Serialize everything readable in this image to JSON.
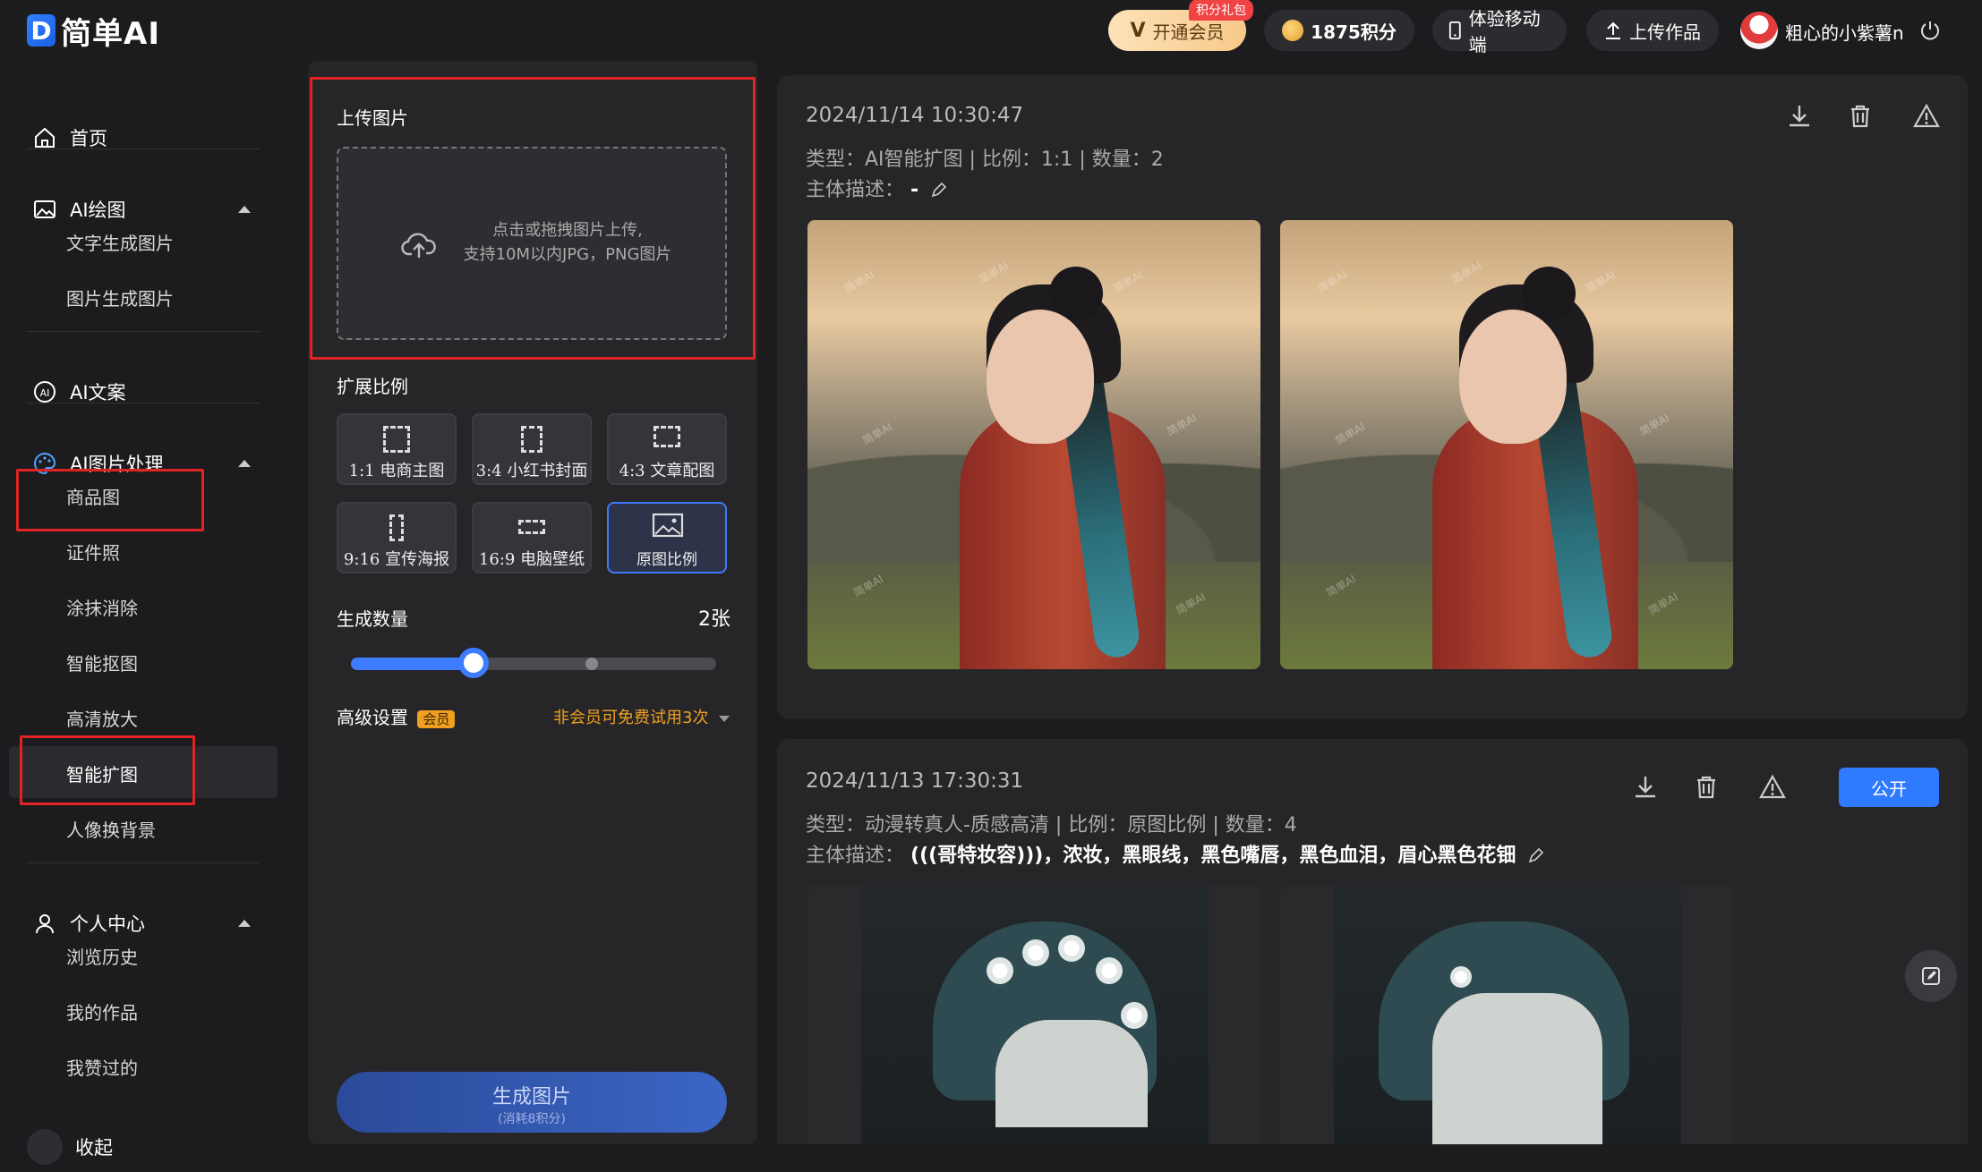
{
  "brand": {
    "logo_letter": "D",
    "name": "简单AI"
  },
  "topbar": {
    "vip": {
      "label": "开通会员",
      "badge": "积分礼包"
    },
    "points": {
      "label": "1875积分"
    },
    "mobile": {
      "label": "体验移动端"
    },
    "upload": {
      "label": "上传作品"
    },
    "user": {
      "name": "粗心的小紫薯n"
    }
  },
  "sidebar": {
    "home": "首页",
    "ai_draw": {
      "label": "AI绘图",
      "items": [
        "文字生成图片",
        "图片生成图片"
      ]
    },
    "ai_copy": "AI文案",
    "ai_image": {
      "label": "AI图片处理",
      "items": [
        "商品图",
        "证件照",
        "涂抹消除",
        "智能抠图",
        "高清放大",
        "智能扩图",
        "人像换背景"
      ]
    },
    "personal": {
      "label": "个人中心",
      "items": [
        "浏览历史",
        "我的作品",
        "我赞过的"
      ]
    },
    "collapse": "收起"
  },
  "panel": {
    "upload_title": "上传图片",
    "upload_hint_1": "点击或拖拽图片上传,",
    "upload_hint_2": "支持10M以内JPG，PNG图片",
    "ratio_title": "扩展比例",
    "ratios": [
      "1:1 电商主图",
      "3:4 小红书封面",
      "4:3 文章配图",
      "9:16 宣传海报",
      "16:9 电脑壁纸",
      "原图比例"
    ],
    "count_title": "生成数量",
    "count_value": "2张",
    "slider_value": 2,
    "advanced_label": "高级设置",
    "advanced_badge": "会员",
    "advanced_note": "非会员可免费试用3次",
    "generate_label": "生成图片",
    "generate_sub": "(消耗8积分)"
  },
  "results": [
    {
      "timestamp": "2024/11/14 10:30:47",
      "meta": "类型：AI智能扩图 | 比例：1:1 | 数量：2",
      "desc_label": "主体描述：",
      "desc_value": "-"
    },
    {
      "timestamp": "2024/11/13 17:30:31",
      "meta": "类型：动漫转真人-质感高清 | 比例：原图比例 | 数量：4",
      "desc_label": "主体描述：",
      "desc_value": "(((哥特妆容)))，浓妆，黑眼线，黑色嘴唇，黑色血泪，眉心黑色花钿",
      "public_label": "公开"
    }
  ],
  "watermark": "简单AI",
  "colors": {
    "accent": "#3d7cff",
    "alert_red": "#e02424",
    "vip_gold": "#f7c98a",
    "advanced_orange": "#f0a020"
  }
}
